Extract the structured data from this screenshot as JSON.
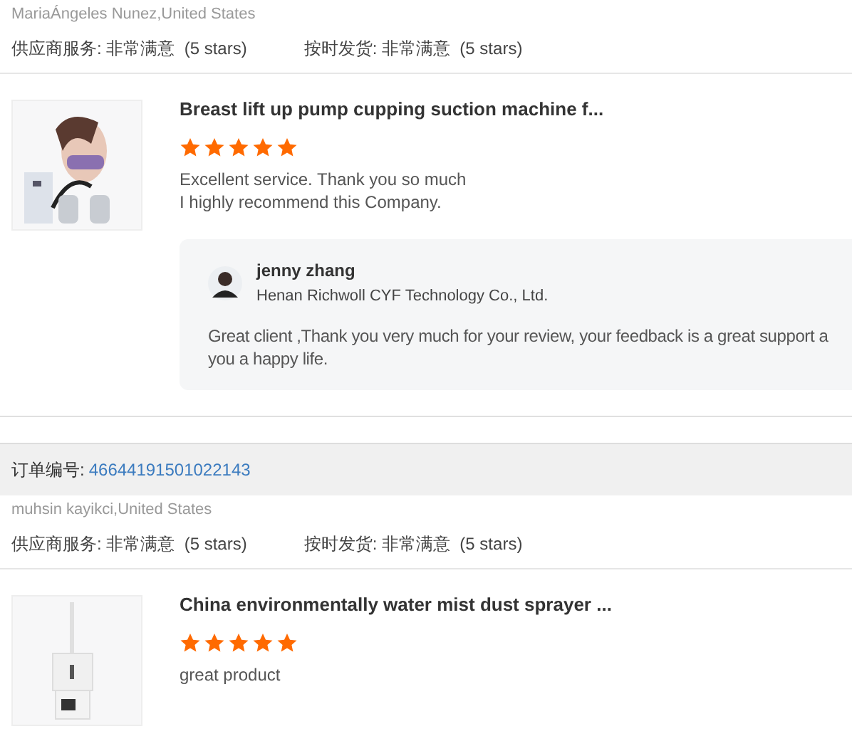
{
  "reviews": [
    {
      "reviewer": "MariaÁngeles Nunez,United States",
      "ratings": [
        {
          "label": "供应商服务:",
          "value": "非常满意",
          "note": "(5 stars)"
        },
        {
          "label": "按时发货:",
          "value": "非常满意",
          "note": "(5 stars)"
        }
      ],
      "product": {
        "title": "Breast lift up pump cupping suction machine f...",
        "stars": 5,
        "comment": [
          "Excellent service. Thank you so much",
          "I highly recommend this Company."
        ]
      },
      "reply": {
        "name": "jenny zhang",
        "company": "Henan Richwoll CYF Technology Co., Ltd.",
        "text": [
          "Great client ,Thank you very much for your review, your feedback is a great support a",
          "you a happy life."
        ]
      }
    },
    {
      "order": {
        "label": "订单编号:",
        "number": "46644191501022143"
      },
      "reviewer": "muhsin kayikci,United States",
      "ratings": [
        {
          "label": "供应商服务:",
          "value": "非常满意",
          "note": "(5 stars)"
        },
        {
          "label": "按时发货:",
          "value": "非常满意",
          "note": "(5 stars)"
        }
      ],
      "product": {
        "title": "China environmentally water mist dust sprayer ...",
        "stars": 5,
        "comment": [
          "great product"
        ]
      }
    }
  ]
}
